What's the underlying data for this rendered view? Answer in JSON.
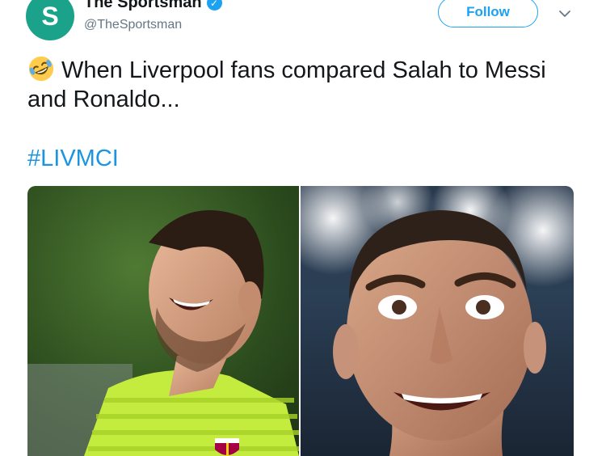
{
  "tweet": {
    "author": {
      "display_name": "The Sportsman",
      "handle": "@TheSportsman",
      "avatar_letter": "S",
      "avatar_color": "#1aa38a",
      "verified_icon": "verified-badge-icon"
    },
    "follow_label": "Follow",
    "menu_icon": "chevron-down-icon",
    "text": "When Liverpool fans compared Salah to Messi and Ronaldo...",
    "emoji": "rolling-on-floor-laughing",
    "hashtag": "#LIVMCI",
    "media": [
      {
        "name": "photo-messi-laughing"
      },
      {
        "name": "photo-ronaldo-face"
      }
    ],
    "colors": {
      "accent": "#1da1f2",
      "hashtag": "#1b95e0",
      "secondary_text": "#657786"
    }
  }
}
